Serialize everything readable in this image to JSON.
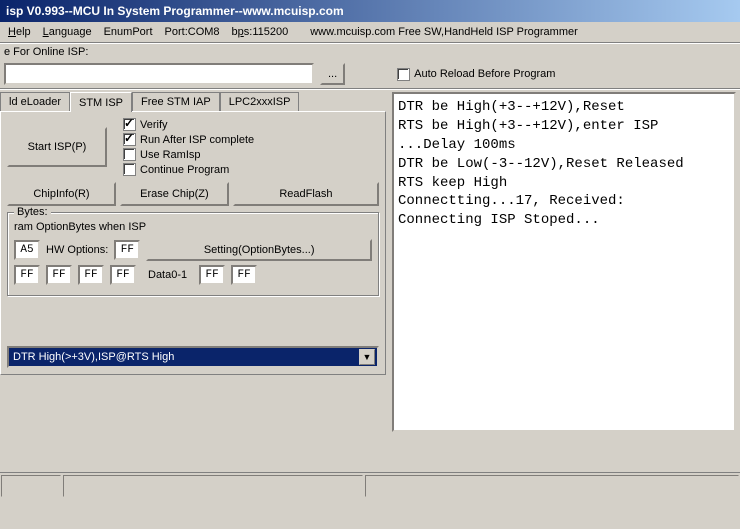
{
  "title": "isp V0.993--MCU In System Programmer--www.mcuisp.com",
  "menu": {
    "help": "Help",
    "language": "Language",
    "enumport": "EnumPort",
    "port": "Port:COM8",
    "bps": "bps:115200",
    "link": "www.mcuisp.com Free SW,HandHeld ISP Programmer"
  },
  "online_label": "e For Online ISP:",
  "path_value": "",
  "browse": "...",
  "auto_reload": "Auto Reload Before Program",
  "tabs": {
    "t1": "ld eLoader",
    "t2": "STM ISP",
    "t3": "Free STM IAP",
    "t4": "LPC2xxxISP"
  },
  "start_isp": "Start ISP(P)",
  "opts": {
    "verify": "Verify",
    "runafter": "Run After ISP complete",
    "useram": "Use RamIsp",
    "contprog": "Continue Program"
  },
  "btns": {
    "chipinfo": "ChipInfo(R)",
    "erase": "Erase Chip(Z)",
    "readflash": "ReadFlash"
  },
  "bytes_group": "Bytes:",
  "prog_opt_label": "ram OptionBytes when ISP",
  "hwopt_label": "HW Options:",
  "setting_btn": "Setting(OptionBytes...)",
  "data01": "Data0-1",
  "hex": {
    "a5": "A5",
    "ff1": "FF",
    "ff2": "FF",
    "ff3": "FF",
    "ff4": "FF",
    "ff5": "FF",
    "ff6": "FF",
    "ff7": "FF"
  },
  "dropdown": "DTR High(>+3V),ISP@RTS High",
  "log": "DTR be High(+3--+12V),Reset\nRTS be High(+3--+12V),enter ISP\n...Delay 100ms\nDTR be Low(-3--12V),Reset Released\nRTS keep High\nConnectting...17, Received:\nConnecting ISP Stoped..."
}
